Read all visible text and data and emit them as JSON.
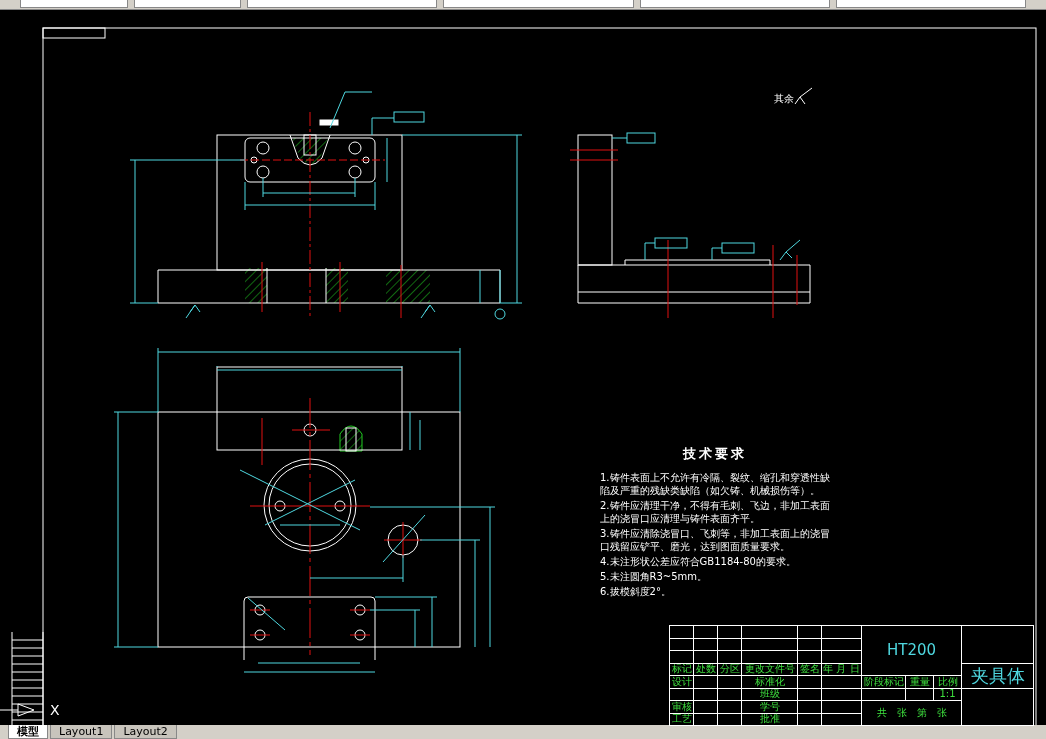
{
  "toolbar": {
    "fields": [
      {
        "kind": "icon-combo"
      },
      {
        "kind": "icon-combo"
      },
      {
        "kind": "combo"
      },
      {
        "kind": "combo"
      },
      {
        "kind": "combo"
      },
      {
        "kind": "combo"
      }
    ]
  },
  "drawing": {
    "roughness_note": "其余",
    "tech_requirements": {
      "title": "技术要求",
      "items": [
        "1.铸件表面上不允许有冷隔、裂纹、缩孔和穿透性缺陷及严重的残缺类缺陷（如欠铸、机械损伤等）。",
        "2.铸件应清理干净，不得有毛刺、飞边，非加工表面上的浇冒口应清理与铸件表面齐平。",
        "3.铸件应清除浇冒口、飞刺等，非加工表面上的浇冒口残留应铲平、磨光，达到图面质量要求。",
        "4.未注形状公差应符合GB1184-80的要求。",
        "5.未注圆角R3~5mm。",
        "6.拔模斜度2°。"
      ]
    },
    "title_block": {
      "material": "HT200",
      "part_name": "夹具体",
      "scale": "1:1",
      "sheet": "共　张　第　张",
      "header": [
        "标记",
        "处数",
        "分区",
        "更改文件号",
        "签名",
        "年 月 日"
      ],
      "rows": [
        {
          "left": "设计",
          "right": "标准化"
        },
        {
          "left": "",
          "right": "班级"
        },
        {
          "left": "审核",
          "right": "学号"
        },
        {
          "left": "工艺",
          "right": "批准"
        }
      ],
      "info_labels": [
        "阶段标记",
        "重量",
        "比例"
      ]
    },
    "ucs_axis_label": "X"
  },
  "layout_tabs": [
    {
      "label": "模型",
      "selected": true
    },
    {
      "label": "Layout1",
      "selected": false
    },
    {
      "label": "Layout2",
      "selected": false
    }
  ]
}
